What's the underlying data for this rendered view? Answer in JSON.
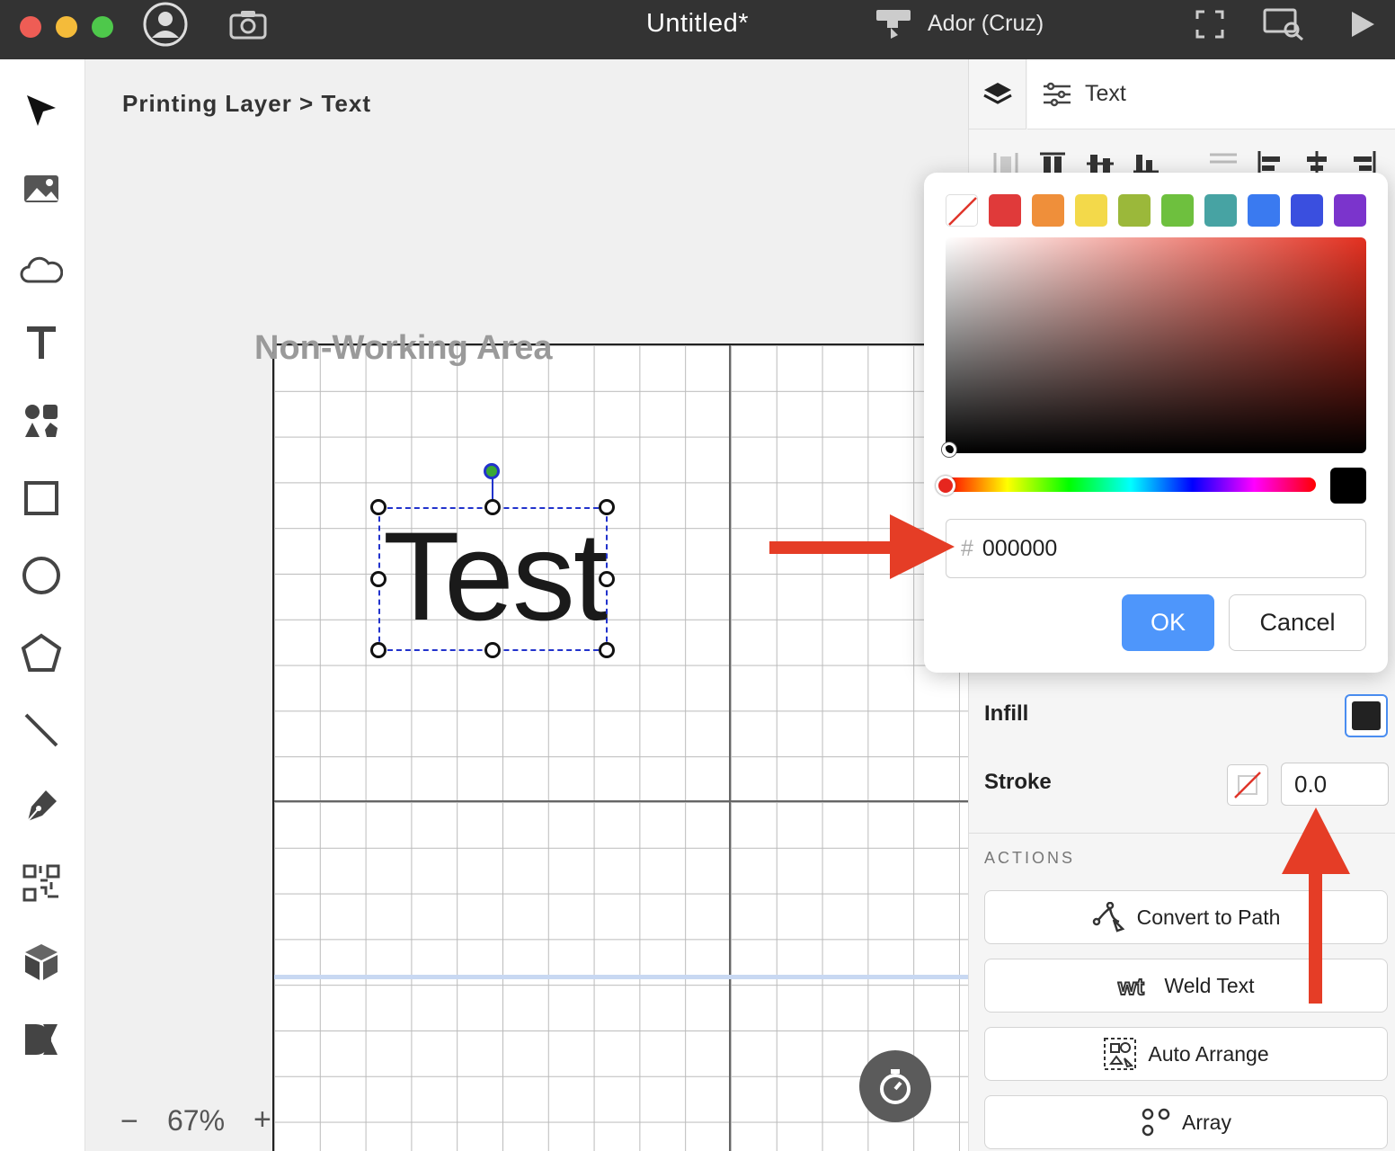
{
  "titlebar": {
    "document_title": "Untitled*",
    "machine_name": "Ador (Cruz)",
    "traffic_lights": [
      "#ee5d55",
      "#f4bb3a",
      "#4ec84b"
    ],
    "icons": [
      "account-icon",
      "camera-icon",
      "machine-icon",
      "frame-icon",
      "preview-icon",
      "play-icon"
    ]
  },
  "toolbar": {
    "tools": [
      "cursor-icon",
      "image-icon",
      "cloud-icon",
      "text-icon",
      "element-icon",
      "rectangle-icon",
      "ellipse-icon",
      "polygon-icon",
      "line-icon",
      "pen-icon",
      "qrcode-icon",
      "cube-icon",
      "dxf-icon"
    ]
  },
  "canvas": {
    "breadcrumb": "Printing Layer > Text",
    "non_working_area_label": "Non-Working Area",
    "selected_text": "Test",
    "zoom": {
      "minus": "−",
      "value": "67%",
      "plus": "+"
    }
  },
  "right_panel": {
    "object_tab_label": "Text",
    "infill_label": "Infill",
    "stroke_label": "Stroke",
    "stroke_width": "0.0",
    "actions_heading": "ACTIONS",
    "actions": [
      {
        "label": "Convert to Path",
        "icon": "convert-path-icon"
      },
      {
        "label": "Weld Text",
        "icon": "weld-text-icon"
      },
      {
        "label": "Auto Arrange",
        "icon": "auto-arrange-icon"
      },
      {
        "label": "Array",
        "icon": "array-icon"
      }
    ]
  },
  "color_picker": {
    "presets": [
      "none",
      "#e03a3a",
      "#ef8f3a",
      "#f3d94a",
      "#9bb83a",
      "#6ec03e",
      "#47a3a3",
      "#3a7af0",
      "#3a4fdf",
      "#7b34cc"
    ],
    "hex_prefix": "#",
    "hex_value": "000000",
    "current_color": "#000000",
    "ok_label": "OK",
    "cancel_label": "Cancel"
  },
  "annotations": {
    "arrow_color": "#e53d26"
  }
}
